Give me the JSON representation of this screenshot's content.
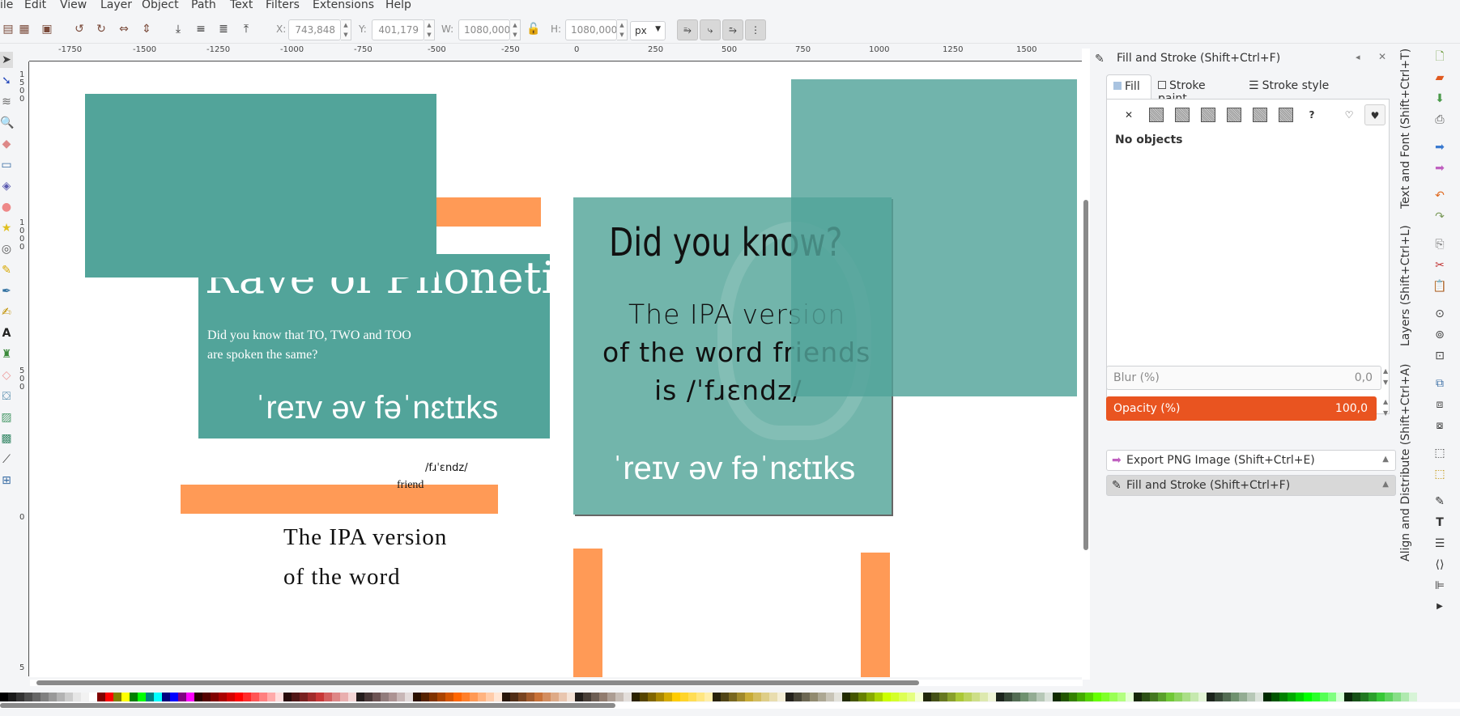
{
  "menu": [
    "ile",
    "Edit",
    "View",
    "Layer",
    "Object",
    "Path",
    "Text",
    "Filters",
    "Extensions",
    "Help"
  ],
  "toolbar": {
    "x_label": "X:",
    "x_value": "743,848",
    "y_label": "Y:",
    "y_value": "401,179",
    "w_label": "W:",
    "w_value": "1080,000",
    "h_label": "H:",
    "h_value": "1080,000",
    "unit": "px"
  },
  "ruler": {
    "h_ticks": [
      "-1750",
      "-1500",
      "-1250",
      "-1000",
      "-750",
      "-500",
      "-250",
      "0",
      "250",
      "500",
      "750",
      "1000",
      "1250",
      "1500"
    ],
    "v_ticks": [
      "1500",
      "1000",
      "500",
      "0",
      "5"
    ]
  },
  "canvas": {
    "colors": {
      "teal": "#52a49a",
      "teal_light": "#72b5ab",
      "orange": "#ff9a56"
    },
    "poster1": {
      "title": "Rave of Phonetics",
      "subtitle_line1": "Did you know that TO, TWO and TOO",
      "subtitle_line2": "are spoken the same?",
      "ipa": "ˈreɪv əv fəˈnɛtɪks"
    },
    "loose_text": {
      "ipa_small": "/fɹˈɛndz/",
      "friend": "friend",
      "ipa_version_line1": "The IPA version",
      "ipa_version_line2": "of the word"
    },
    "poster2": {
      "heading": "Did you know?",
      "line1": "The IPA version",
      "line2": "of the word friends",
      "line3": "is /ˈfɹɛndz/",
      "ipa": "ˈreɪv əv fəˈnɛtɪks"
    }
  },
  "panel": {
    "title": "Fill and Stroke (Shift+Ctrl+F)",
    "tabs": [
      "Fill",
      "Stroke paint",
      "Stroke style"
    ],
    "fill_types": [
      "none-icon",
      "flat-color-icon",
      "linear-gradient-icon",
      "radial-gradient-icon",
      "mesh-gradient-icon",
      "pattern-icon",
      "swatch-icon",
      "unset-icon",
      "evenodd-icon",
      "nonzero-icon"
    ],
    "status": "No objects",
    "blur_label": "Blur (%)",
    "blur_value": "0,0",
    "opacity_label": "Opacity (%)",
    "opacity_value": "100,0",
    "opacity_color": "#e95420",
    "docked": [
      "Export PNG Image (Shift+Ctrl+E)",
      "Fill and Stroke (Shift+Ctrl+F)"
    ]
  },
  "vertical_tabs": [
    "Text and Font (Shift+Ctrl+T)",
    "Layers (Shift+Ctrl+L)",
    "Align and Distribute (Shift+Ctrl+A)"
  ]
}
